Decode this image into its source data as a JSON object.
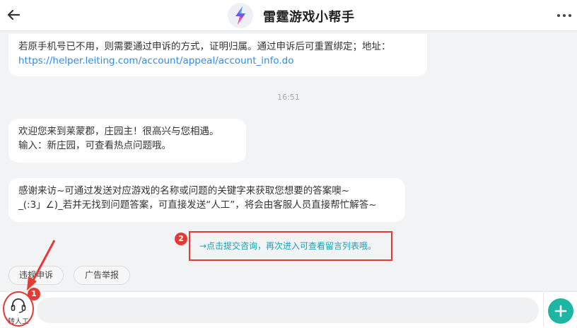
{
  "header": {
    "title": "雷霆游戏小帮手",
    "back_icon": "back-arrow-icon",
    "logo_icon": "thunder-logo-icon",
    "more_icon": "more-dots-icon"
  },
  "messages": [
    {
      "text": "若原手机号已不用，则需要通过申诉的方式，证明归属。通过申诉后可重置绑定；地址：",
      "link": "https://helper.leiting.com/account/appeal/account_info.do"
    },
    {
      "line1": "欢迎您来到莱蒙郡，庄园主！很高兴与您相遇。",
      "line2": "输入：新庄园，可查看热点问题哦。"
    },
    {
      "line1": "感谢来访~可通过发送对应游戏的名称或问题的关键字来获取您想要的答案噢~",
      "line2": "_(:3」∠)_若并无找到问题答案，可直接发送“人工”，将会由客服人员直接帮忙解答~"
    }
  ],
  "timestamp": "16:51",
  "notice": "→点击提交咨询，再次进入可查看留言列表哦。",
  "annotations": {
    "badge1": "1",
    "badge2": "2",
    "color": "#e53935"
  },
  "quick_replies": [
    "违规申诉",
    "广告举报"
  ],
  "input_bar": {
    "agent_label": "转人工",
    "agent_icon": "headset-icon",
    "placeholder": "",
    "plus_icon": "plus-icon"
  },
  "colors": {
    "accent": "#1fb5a5",
    "link": "#2d8cf0",
    "notice": "#17a2b8"
  }
}
